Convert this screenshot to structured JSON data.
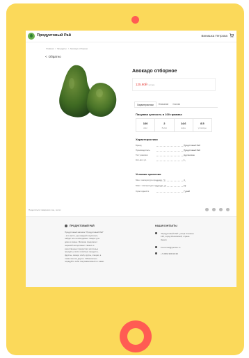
{
  "header": {
    "brand": "Продуктовый Рай",
    "user_name": "Винишка Петрова"
  },
  "breadcrumb": [
    "Главная",
    "/",
    "Продукты",
    "/",
    "Авокадо отборное"
  ],
  "back_label": "Обратно",
  "product": {
    "title": "Авокадо отборное",
    "price": "125.90₽",
    "price_unit": "/ штука"
  },
  "tabs": [
    {
      "label": "Характеристики",
      "active": true
    },
    {
      "label": "Описание",
      "active": false
    },
    {
      "label": "Состав",
      "active": false
    }
  ],
  "nutrition": {
    "title": "Пищевая ценность в 100 граммах",
    "cells": [
      {
        "value": "160",
        "label": "ккал"
      },
      {
        "value": "2",
        "label": "белки"
      },
      {
        "value": "14.6",
        "label": "жиры"
      },
      {
        "value": "8.5",
        "label": "углеводы"
      }
    ]
  },
  "specs": {
    "title": "Характеристики",
    "rows": [
      {
        "key": "Бренд",
        "value": "Продуктовый Рай"
      },
      {
        "key": "Производитель",
        "value": "Продуктовый Рай"
      },
      {
        "key": "Тип упаковки",
        "value": "Неупакован"
      },
      {
        "key": "Кол-во в уп.",
        "value": "1"
      }
    ]
  },
  "storage": {
    "title": "Условия хранения",
    "rows": [
      {
        "key": "Мин. температура хранения, °C",
        "value": "4"
      },
      {
        "key": "Макс. температура хранения, °C",
        "value": "10"
      },
      {
        "key": "Срок годности",
        "value": "7 дней"
      }
    ]
  },
  "share_label": "Поделиться товаром в соц. сетях",
  "footer": {
    "brand": "ПРОДУКТОВЫЙ РАЙ",
    "about": "Продуктовый магазин \"Продуктовый Рай\" - это место, где каждый покупатель найдет все необходимые товары для дома и семьи. Магазин предлагает широкий ассортимент свежих и качественных продуктов: молочные продукты, мясо и мясные продукты, фрукты, овощи, хлеб, крупы, специи, а также многое другое. Обязательно порадуйте себя покупками вместе с нами.",
    "contacts_title": "НАШИ КОНТАКТЫ",
    "address": "\"Продуктовый Рай\", улица Станина 120, город Московский, страна Земля",
    "email": "Food.mail@yandex.ru",
    "phone": "+7 (999) 999-99-99"
  },
  "colors": {
    "tablet_frame": "#fbd95a",
    "accent": "#ff5c53",
    "price": "#e53935"
  }
}
